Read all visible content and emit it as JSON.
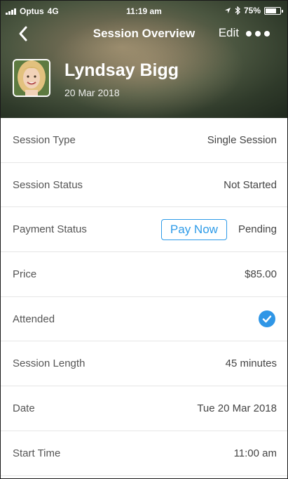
{
  "status_bar": {
    "carrier": "Optus",
    "network": "4G",
    "time": "11:19 am",
    "battery": "75%",
    "battery_level": 0.75
  },
  "nav": {
    "title": "Session Overview",
    "edit_label": "Edit",
    "back_icon": "chevron-left-icon",
    "more_icon": "more-dots-icon"
  },
  "profile": {
    "name": "Lyndsay Bigg",
    "date": "20 Mar 2018"
  },
  "rows": {
    "session_type": {
      "label": "Session Type",
      "value": "Single Session"
    },
    "session_status": {
      "label": "Session Status",
      "value": "Not Started"
    },
    "payment_status": {
      "label": "Payment Status",
      "button": "Pay Now",
      "value": "Pending"
    },
    "price": {
      "label": "Price",
      "value": "$85.00"
    },
    "attended": {
      "label": "Attended",
      "checked": true
    },
    "session_length": {
      "label": "Session Length",
      "value": "45 minutes"
    },
    "date": {
      "label": "Date",
      "value": "Tue 20 Mar 2018"
    },
    "start_time": {
      "label": "Start Time",
      "value": "11:00 am"
    }
  },
  "colors": {
    "accent": "#2e9be8",
    "divider": "#e6e6e6"
  }
}
